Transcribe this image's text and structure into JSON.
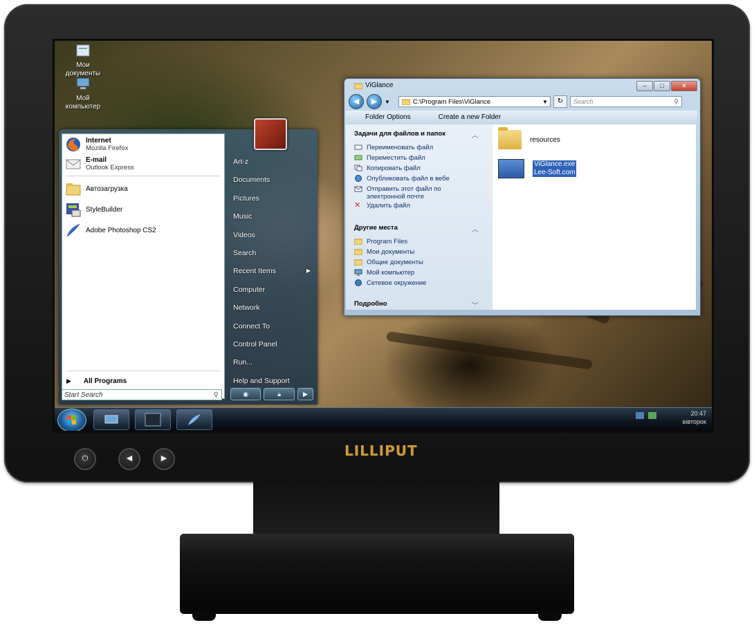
{
  "desktop_icons": [
    {
      "label": "Мои документы",
      "icon": "documents-icon"
    },
    {
      "label": "Мой компьютер",
      "icon": "computer-icon"
    }
  ],
  "start_menu": {
    "pinned": [
      {
        "title": "Internet",
        "subtitle": "Mozilla Firefox",
        "icon": "firefox-icon"
      },
      {
        "title": "E-mail",
        "subtitle": "Outlook Express",
        "icon": "mail-icon"
      }
    ],
    "recent": [
      {
        "label": "Автозагрузка",
        "icon": "folder-icon"
      },
      {
        "label": "StyleBuilder",
        "icon": "stylebuilder-icon"
      },
      {
        "label": "Adobe Photoshop CS2",
        "icon": "photoshop-feather-icon"
      }
    ],
    "all_programs": "All Programs",
    "search_placeholder": "Start Search",
    "right_items": [
      "Art-z",
      "Documents",
      "Pictures",
      "Music",
      "Videos",
      "Search",
      "Recent Items",
      "Computer",
      "Network",
      "Connect To",
      "Control Panel",
      "Run...",
      "Help and Support"
    ]
  },
  "explorer": {
    "title": "ViGlance",
    "address": "C:\\Program Files\\ViGlance",
    "search_placeholder": "Search",
    "toolbar": [
      "Folder Options",
      "Create a new Folder"
    ],
    "task_group_1": {
      "heading": "Задачи для файлов и папок",
      "items": [
        "Переименовать файл",
        "Переместить файл",
        "Копировать файл",
        "Опубликовать файл в вебе",
        "Отправить этот файл по электронной почте",
        "Удалить файл"
      ]
    },
    "task_group_2": {
      "heading": "Другие места",
      "items": [
        "Program Files",
        "Мои документы",
        "Общие документы",
        "Мой компьютер",
        "Сетевое окружение"
      ]
    },
    "task_group_3": {
      "heading": "Подробно"
    },
    "files": [
      {
        "name": "resources",
        "type": "folder"
      },
      {
        "name": "ViGlance.exe",
        "subtitle": "Lee-Soft.com",
        "type": "exe",
        "selected": true
      }
    ]
  },
  "taskbar": {
    "time": "20:47",
    "day": "вівторок"
  },
  "brand": "LILLIPUT"
}
